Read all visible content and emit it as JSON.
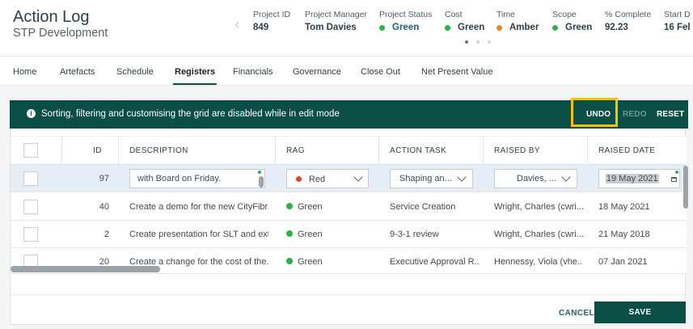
{
  "header": {
    "title": "Action Log",
    "subtitle": "STP Development",
    "meta": [
      {
        "label": "Project ID",
        "value": "849"
      },
      {
        "label": "Project Manager",
        "value": "Tom Davies"
      },
      {
        "label": "Project Status",
        "value": "Green",
        "dot": "#2db14a"
      },
      {
        "label": "Cost",
        "value": "Green",
        "dot": "#2db14a"
      },
      {
        "label": "Time",
        "value": "Amber",
        "dot": "#e8892b"
      },
      {
        "label": "Scope",
        "value": "Green",
        "dot": "#2db14a"
      },
      {
        "label": "% Complete",
        "value": "92.23"
      },
      {
        "label": "Start D",
        "value": "16 Fel"
      }
    ]
  },
  "tabs": [
    "Home",
    "Artefacts",
    "Schedule",
    "Registers",
    "Financials",
    "Governance",
    "Close Out",
    "Net Present Value"
  ],
  "active_tab": "Registers",
  "banner": {
    "message": "Sorting, filtering and customising the grid are disabled while in edit mode",
    "undo": "UNDO",
    "redo": "REDO",
    "reset": "RESET"
  },
  "grid": {
    "columns": [
      "ID",
      "DESCRIPTION",
      "RAG",
      "ACTION TASK",
      "RAISED BY",
      "RAISED DATE"
    ],
    "edit_row": {
      "id": "97",
      "description": "with Board on Friday.",
      "rag": "Red",
      "action_task": "Shaping an...",
      "raised_by": "Davies, ...",
      "raised_date": "19 May 2021"
    },
    "rows": [
      {
        "id": "40",
        "description": "Create a demo for the new CityFibr...",
        "rag": "Green",
        "action_task": "Service Creation",
        "raised_by": "Wright, Charles (cwri...",
        "raised_date": "18 May 2021"
      },
      {
        "id": "2",
        "description": "Create presentation for SLT and ext...",
        "rag": "Green",
        "action_task": "9-3-1 review",
        "raised_by": "Wright, Charles (cwri...",
        "raised_date": "21 May 2018"
      },
      {
        "id": "20",
        "description": "Create a change for the cost of the...",
        "rag": "Green",
        "action_task": "Executive Approval R...",
        "raised_by": "Hennessy, Viola (vhe...",
        "raised_date": "07 Jan 2021"
      }
    ]
  },
  "footer": {
    "cancel": "CANCEL",
    "save": "SAVE"
  },
  "colors": {
    "brand": "#0b4e46",
    "highlight": "#f5c400",
    "green": "#2db14a",
    "red": "#d9452f",
    "amber": "#e8892b"
  }
}
